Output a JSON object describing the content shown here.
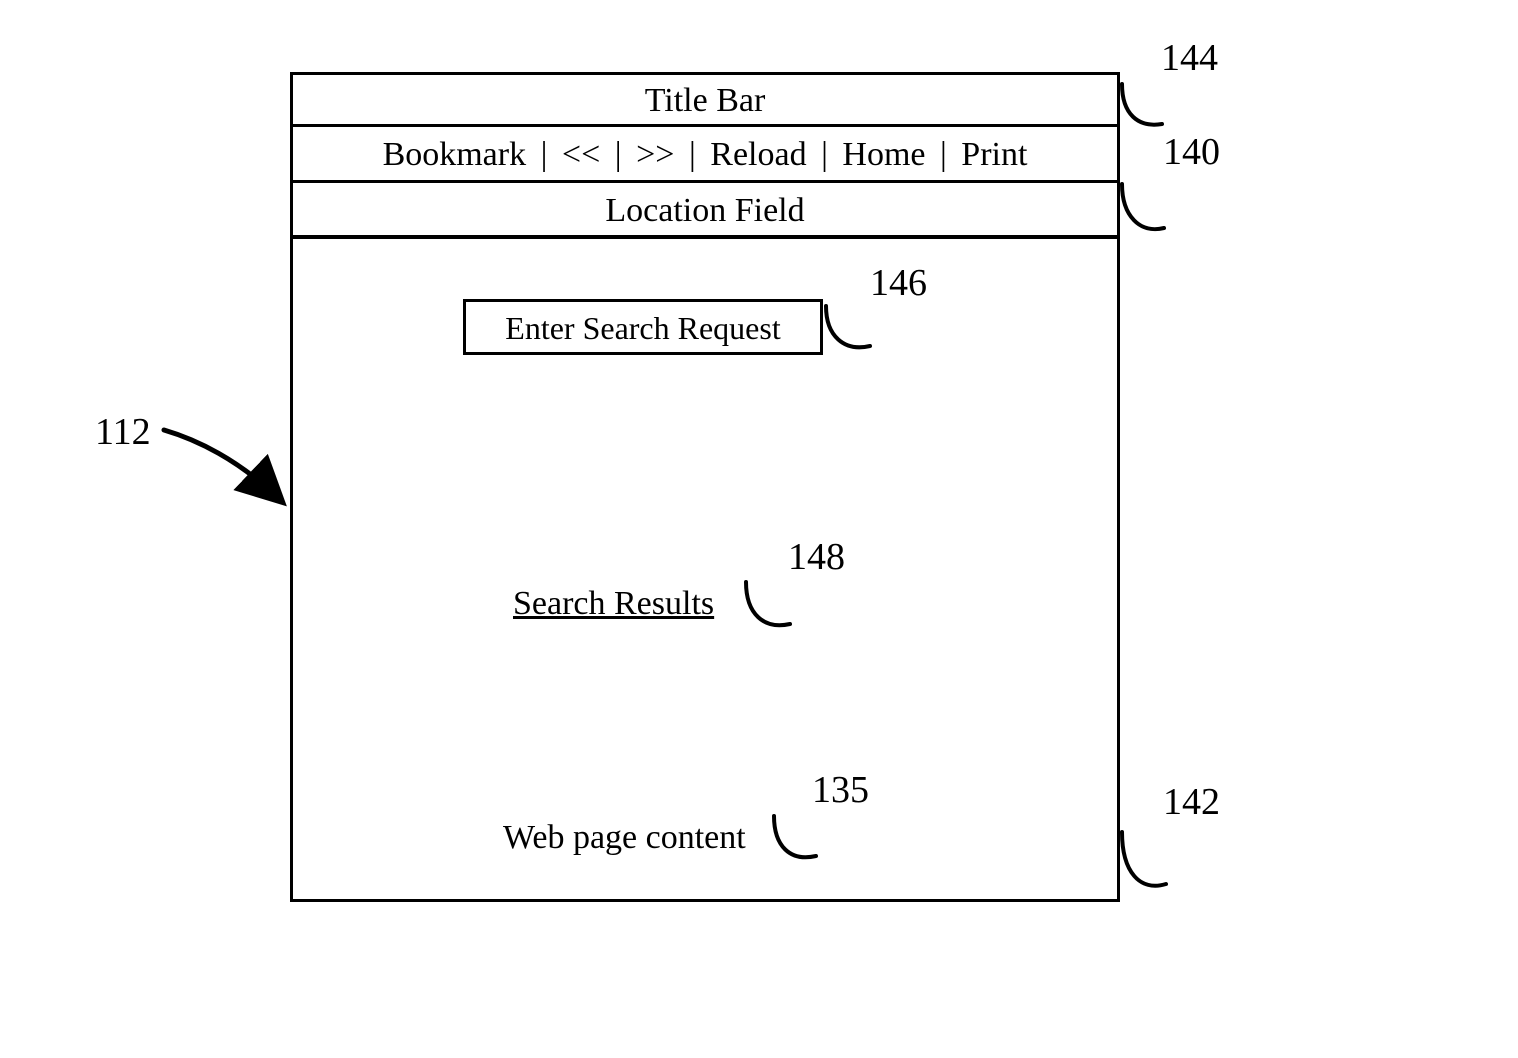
{
  "title_bar": {
    "label": "Title Bar"
  },
  "toolbar": {
    "items": [
      "Bookmark",
      "<<",
      ">>",
      "Reload",
      "Home",
      "Print"
    ],
    "separator": "|"
  },
  "location_bar": {
    "label": "Location Field"
  },
  "content": {
    "search_field_label": "Enter Search Request",
    "search_results_label": "Search Results",
    "webpage_label": "Web page content"
  },
  "reference_numbers": {
    "title_bar": "144",
    "toolbar_and_location": "140",
    "browser_window": "112",
    "search_field": "146",
    "search_results": "148",
    "webpage_content": "135",
    "content_area": "142"
  }
}
